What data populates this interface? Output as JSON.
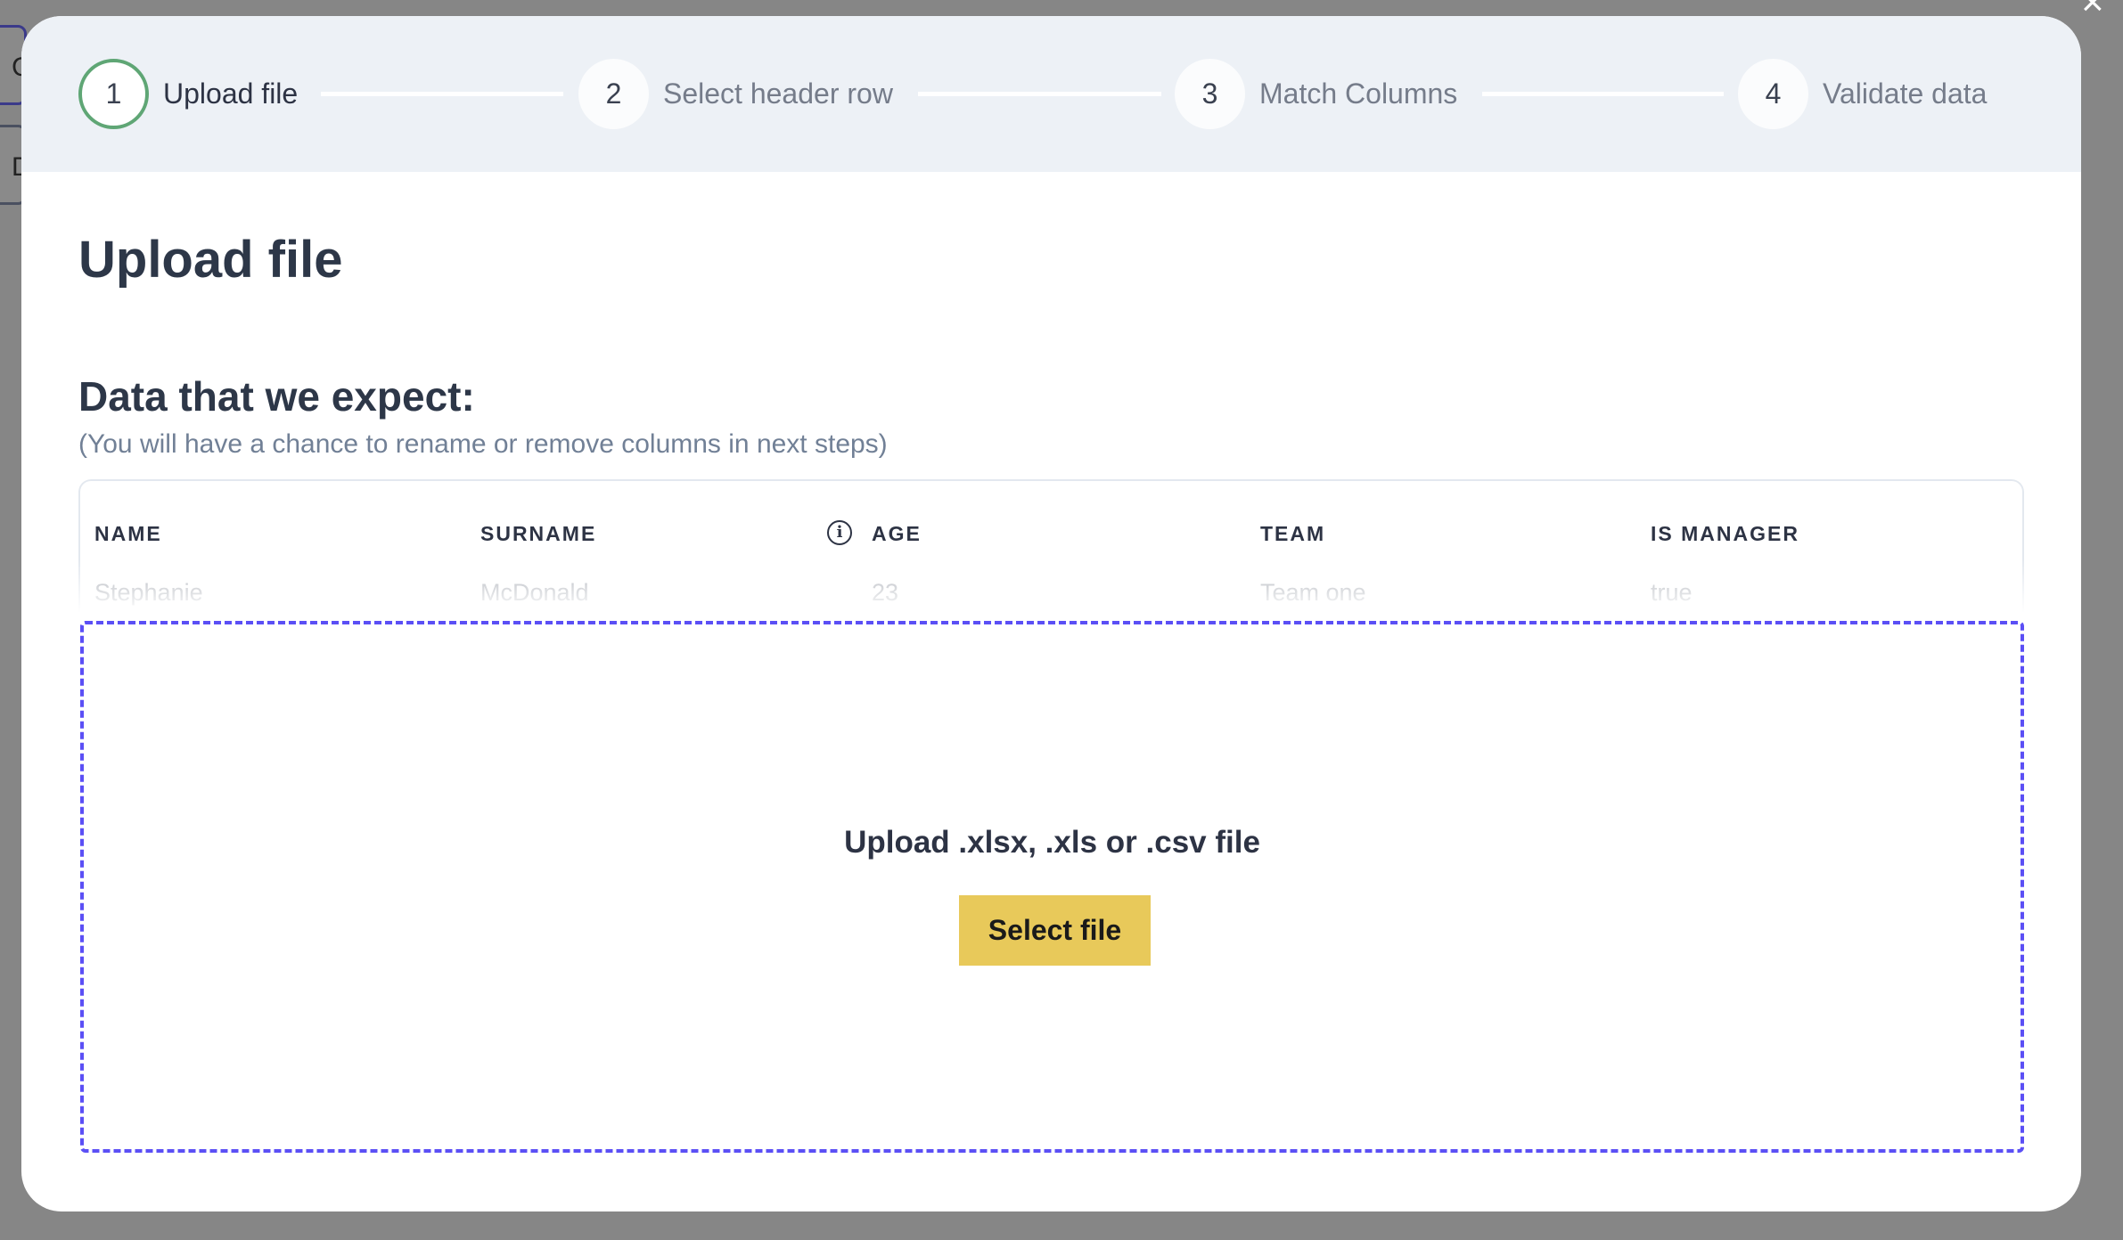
{
  "background": {
    "partial_buttons": [
      "C",
      "D"
    ],
    "close_icon": "close-icon"
  },
  "steps": [
    {
      "number": "1",
      "label": "Upload file",
      "active": true
    },
    {
      "number": "2",
      "label": "Select header row",
      "active": false
    },
    {
      "number": "3",
      "label": "Match Columns",
      "active": false
    },
    {
      "number": "4",
      "label": "Validate data",
      "active": false
    }
  ],
  "title": "Upload file",
  "expect": {
    "heading": "Data that we expect:",
    "subtitle": "(You will have a chance to rename or remove columns in next steps)",
    "columns": [
      "NAME",
      "SURNAME",
      "AGE",
      "TEAM",
      "IS MANAGER"
    ],
    "example_row": [
      "Stephanie",
      "McDonald",
      "23",
      "Team one",
      "true"
    ],
    "info_icon": "info-icon"
  },
  "dropzone": {
    "text": "Upload .xlsx, .xls or .csv file",
    "button": "Select file"
  },
  "colors": {
    "accent_dash": "#5b4ff5",
    "button": "#e8c95a",
    "active_step": "#5fa675"
  }
}
